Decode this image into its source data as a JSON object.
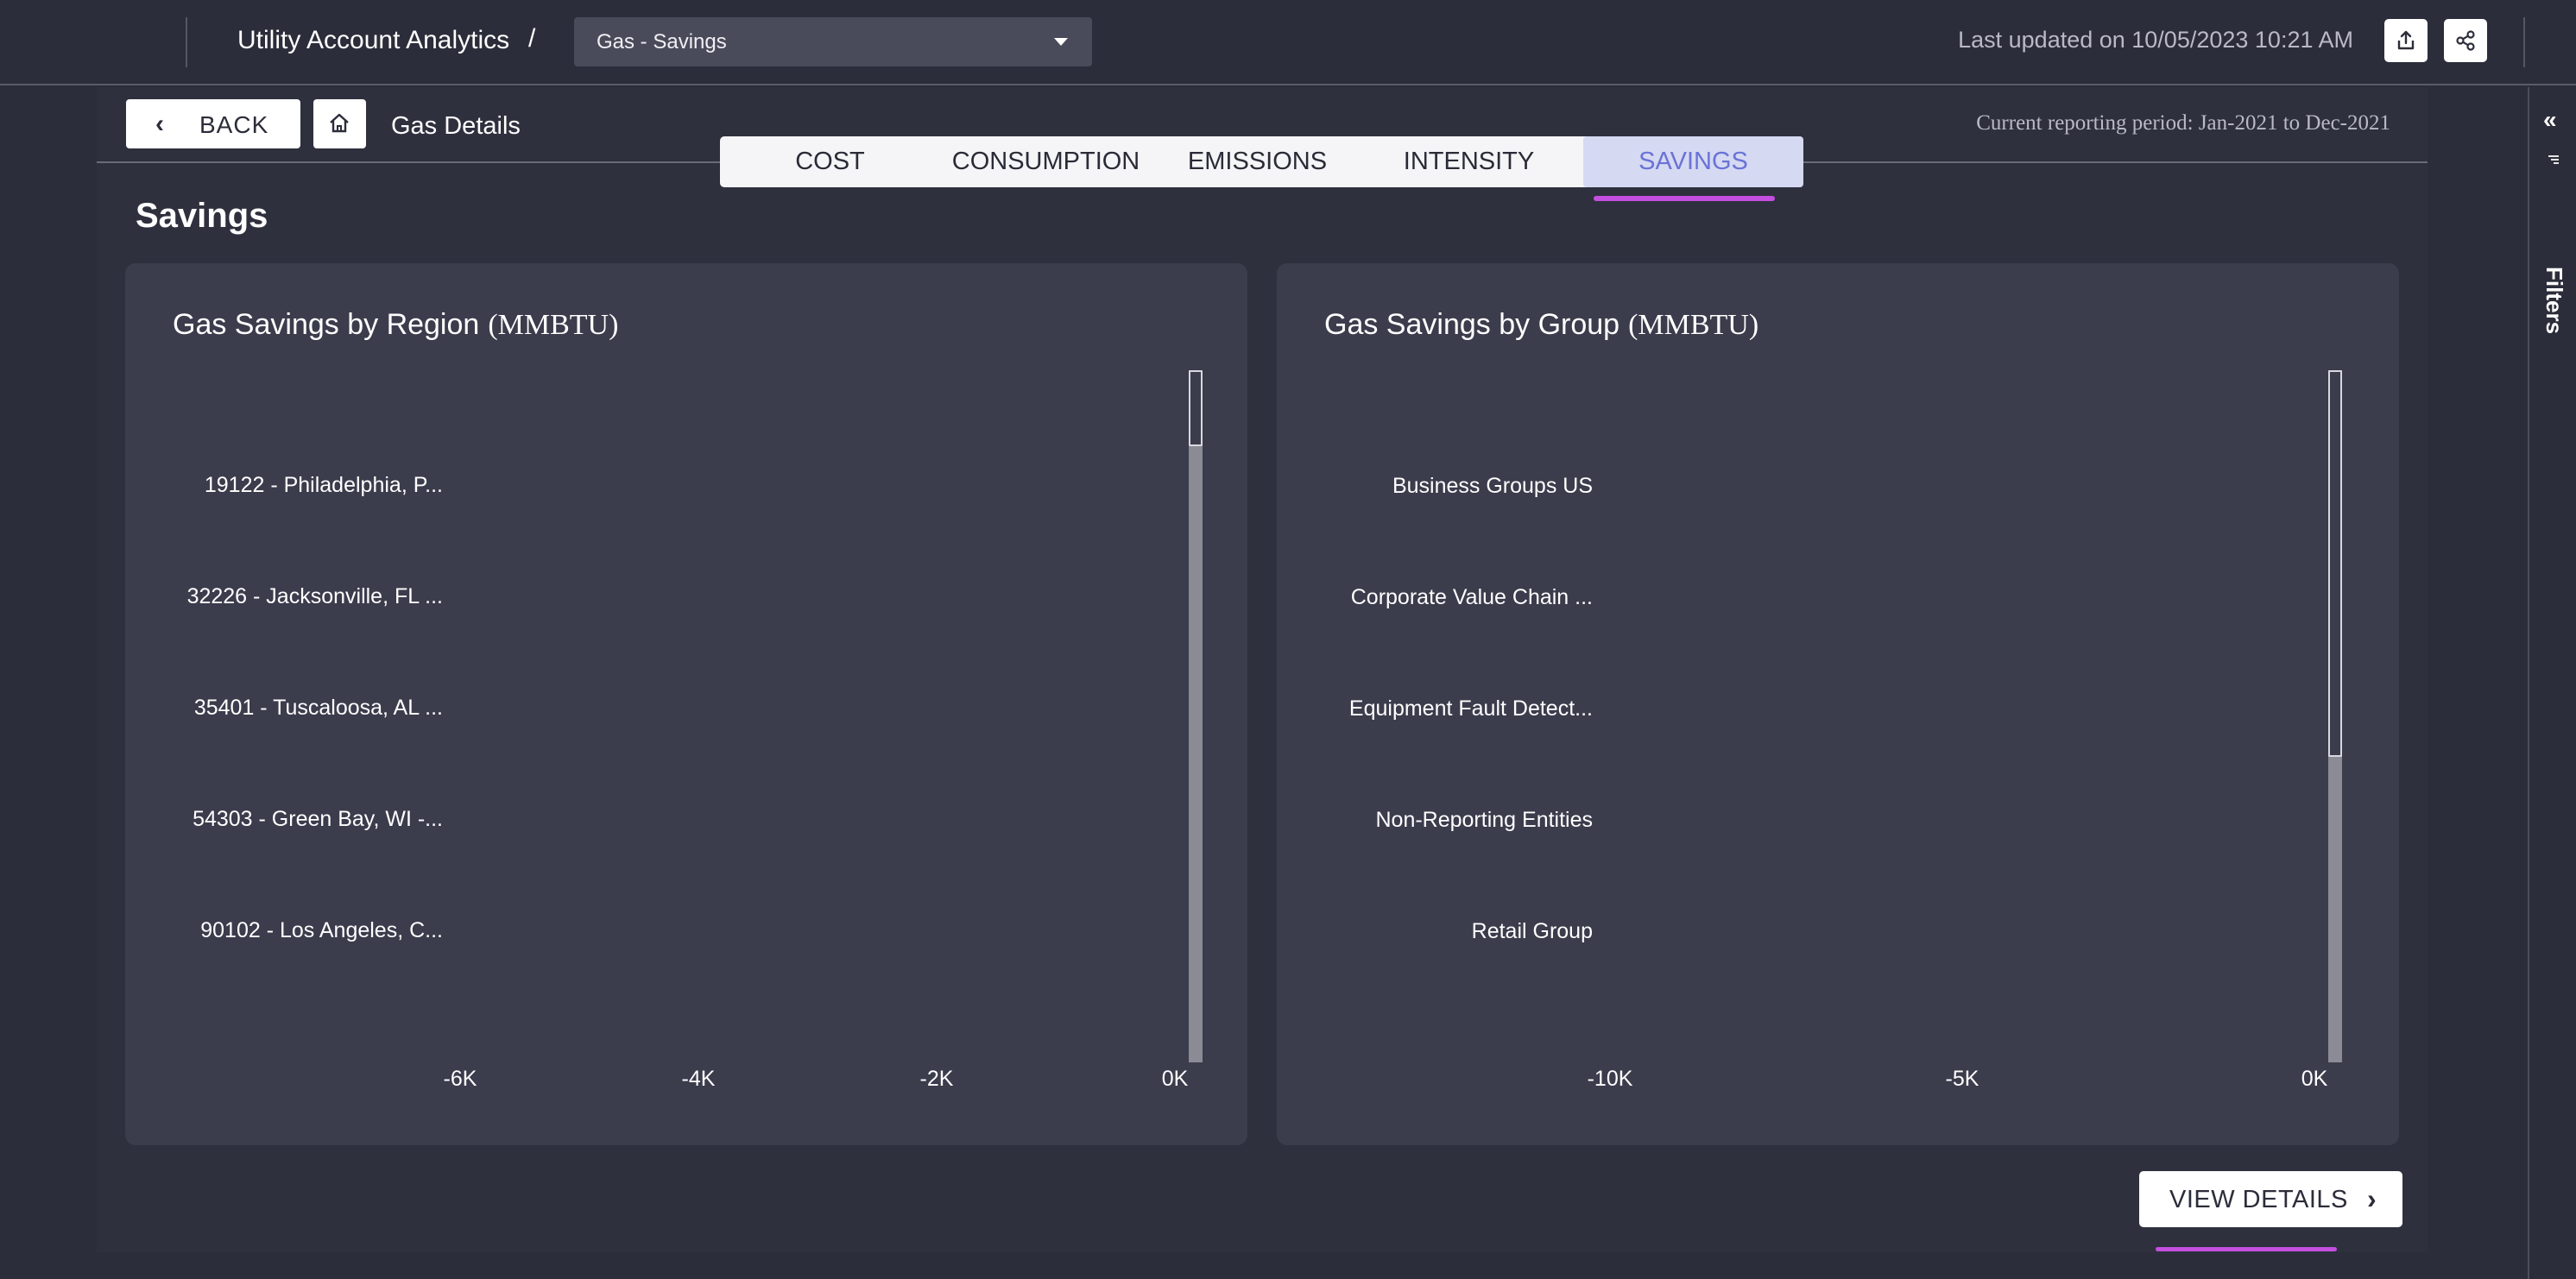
{
  "header": {
    "app_title": "Utility Account Analytics",
    "separator": "/",
    "view_select": {
      "value": "Gas - Savings"
    },
    "last_updated": "Last updated on 10/05/2023 10:21 AM",
    "export_icon": "export-icon",
    "share_icon": "share-icon"
  },
  "filters_rail": {
    "label": "Filters",
    "collapse_icon": "double-chevron-left-icon"
  },
  "page": {
    "back_label": "BACK",
    "home_icon": "home-icon",
    "title": "Gas Details",
    "reporting_period": "Current reporting period: Jan-2021 to Dec-2021"
  },
  "tabs": [
    {
      "label": "COST",
      "active": false
    },
    {
      "label": "CONSUMPTION",
      "active": false
    },
    {
      "label": "EMISSIONS",
      "active": false
    },
    {
      "label": "INTENSITY",
      "active": false
    },
    {
      "label": "SAVINGS",
      "active": true
    }
  ],
  "section_title": "Savings",
  "view_details_label": "VIEW DETAILS",
  "colors": {
    "accent": "#c44fe0",
    "active_tab_bg": "#d6d9f2",
    "active_tab_text": "#6973d6",
    "card_bg": "#3b3c4c",
    "page_bg": "#2c2d3a"
  },
  "chart_data": [
    {
      "type": "bar",
      "orientation": "horizontal",
      "title": "Gas Savings by Region",
      "unit": "(MMBTU)",
      "categories": [
        "19122 - Philadelphia, P...",
        "32226 - Jacksonville, FL ...",
        "35401 - Tuscaloosa, AL ...",
        "54303 - Green Bay, WI -...",
        "90102 - Los Angeles, C..."
      ],
      "values": [
        0,
        0,
        0,
        0,
        0
      ],
      "xlim": [
        -6000,
        0
      ],
      "ticks": [
        {
          "value": -6000,
          "label": "-6K"
        },
        {
          "value": -4000,
          "label": "-4K"
        },
        {
          "value": -2000,
          "label": "-2K"
        },
        {
          "value": 0,
          "label": "0K"
        }
      ],
      "grid": false
    },
    {
      "type": "bar",
      "orientation": "horizontal",
      "title": "Gas Savings by Group",
      "unit": "(MMBTU)",
      "categories": [
        "Business Groups US",
        "Corporate Value Chain ...",
        "Equipment Fault Detect...",
        "Non-Reporting Entities",
        "Retail Group"
      ],
      "values": [
        0,
        0,
        0,
        0,
        0
      ],
      "xlim": [
        -10000,
        0
      ],
      "ticks": [
        {
          "value": -10000,
          "label": "-10K"
        },
        {
          "value": -5000,
          "label": "-5K"
        },
        {
          "value": 0,
          "label": "0K"
        }
      ],
      "grid": false
    }
  ]
}
